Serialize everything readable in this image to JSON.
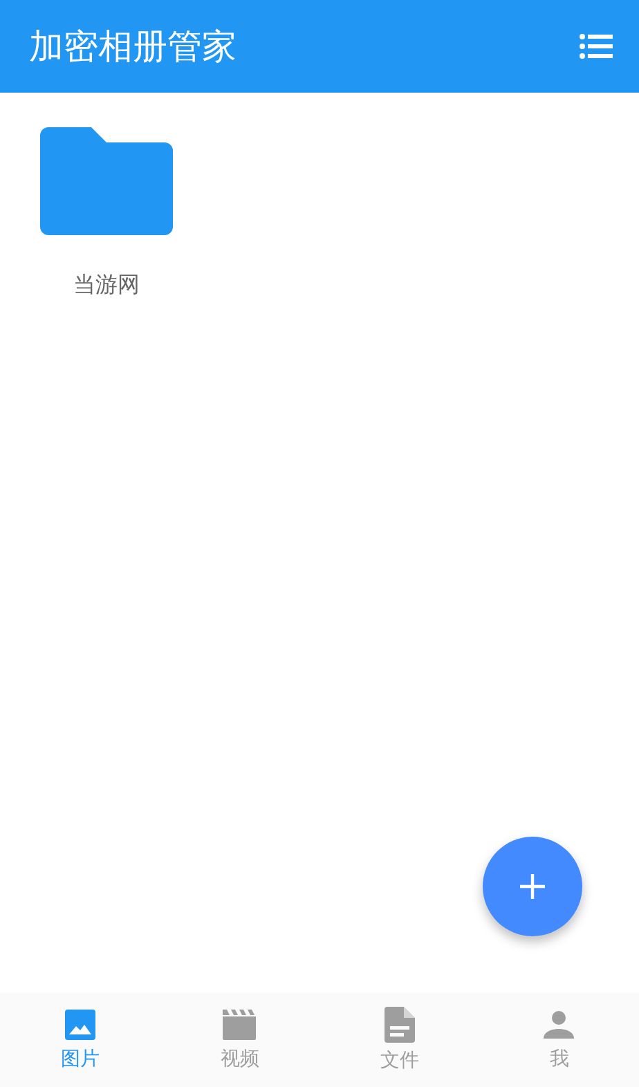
{
  "app_bar": {
    "title": "加密相册管家"
  },
  "folders": [
    {
      "name": "当游网"
    }
  ],
  "bottom_nav": [
    {
      "label": "图片",
      "kind": "image",
      "selected": true
    },
    {
      "label": "视频",
      "kind": "video",
      "selected": false
    },
    {
      "label": "文件",
      "kind": "file",
      "selected": false
    },
    {
      "label": "我",
      "kind": "person",
      "selected": false
    }
  ]
}
